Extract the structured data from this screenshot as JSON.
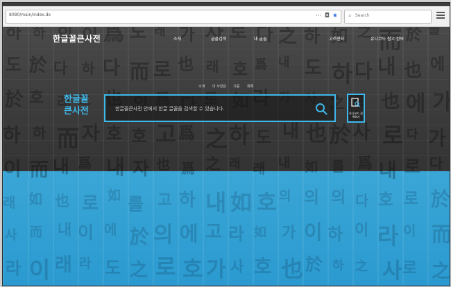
{
  "browser": {
    "url": "8080/main/index.do",
    "search_placeholder": "Search"
  },
  "site": {
    "logo": "한글꼴큰사전",
    "nav": [
      "소개",
      "글꼴검색",
      "내 글꼴",
      "고객센터",
      "유니코드 참고 정보"
    ],
    "subnav": [
      "소개",
      "이 사전은",
      "기증",
      "목록"
    ],
    "hero_title_line1": "한글꼴",
    "hero_title_line2": "큰사전",
    "search_placeholder": "한글꼴큰사전 안에서 한글 글꼴을 검색할 수 있습니다.",
    "side_button_label": "유니코드 검색하기"
  },
  "colors": {
    "accent": "#3fb8ea",
    "lower_band": "#2b9ad0"
  }
}
